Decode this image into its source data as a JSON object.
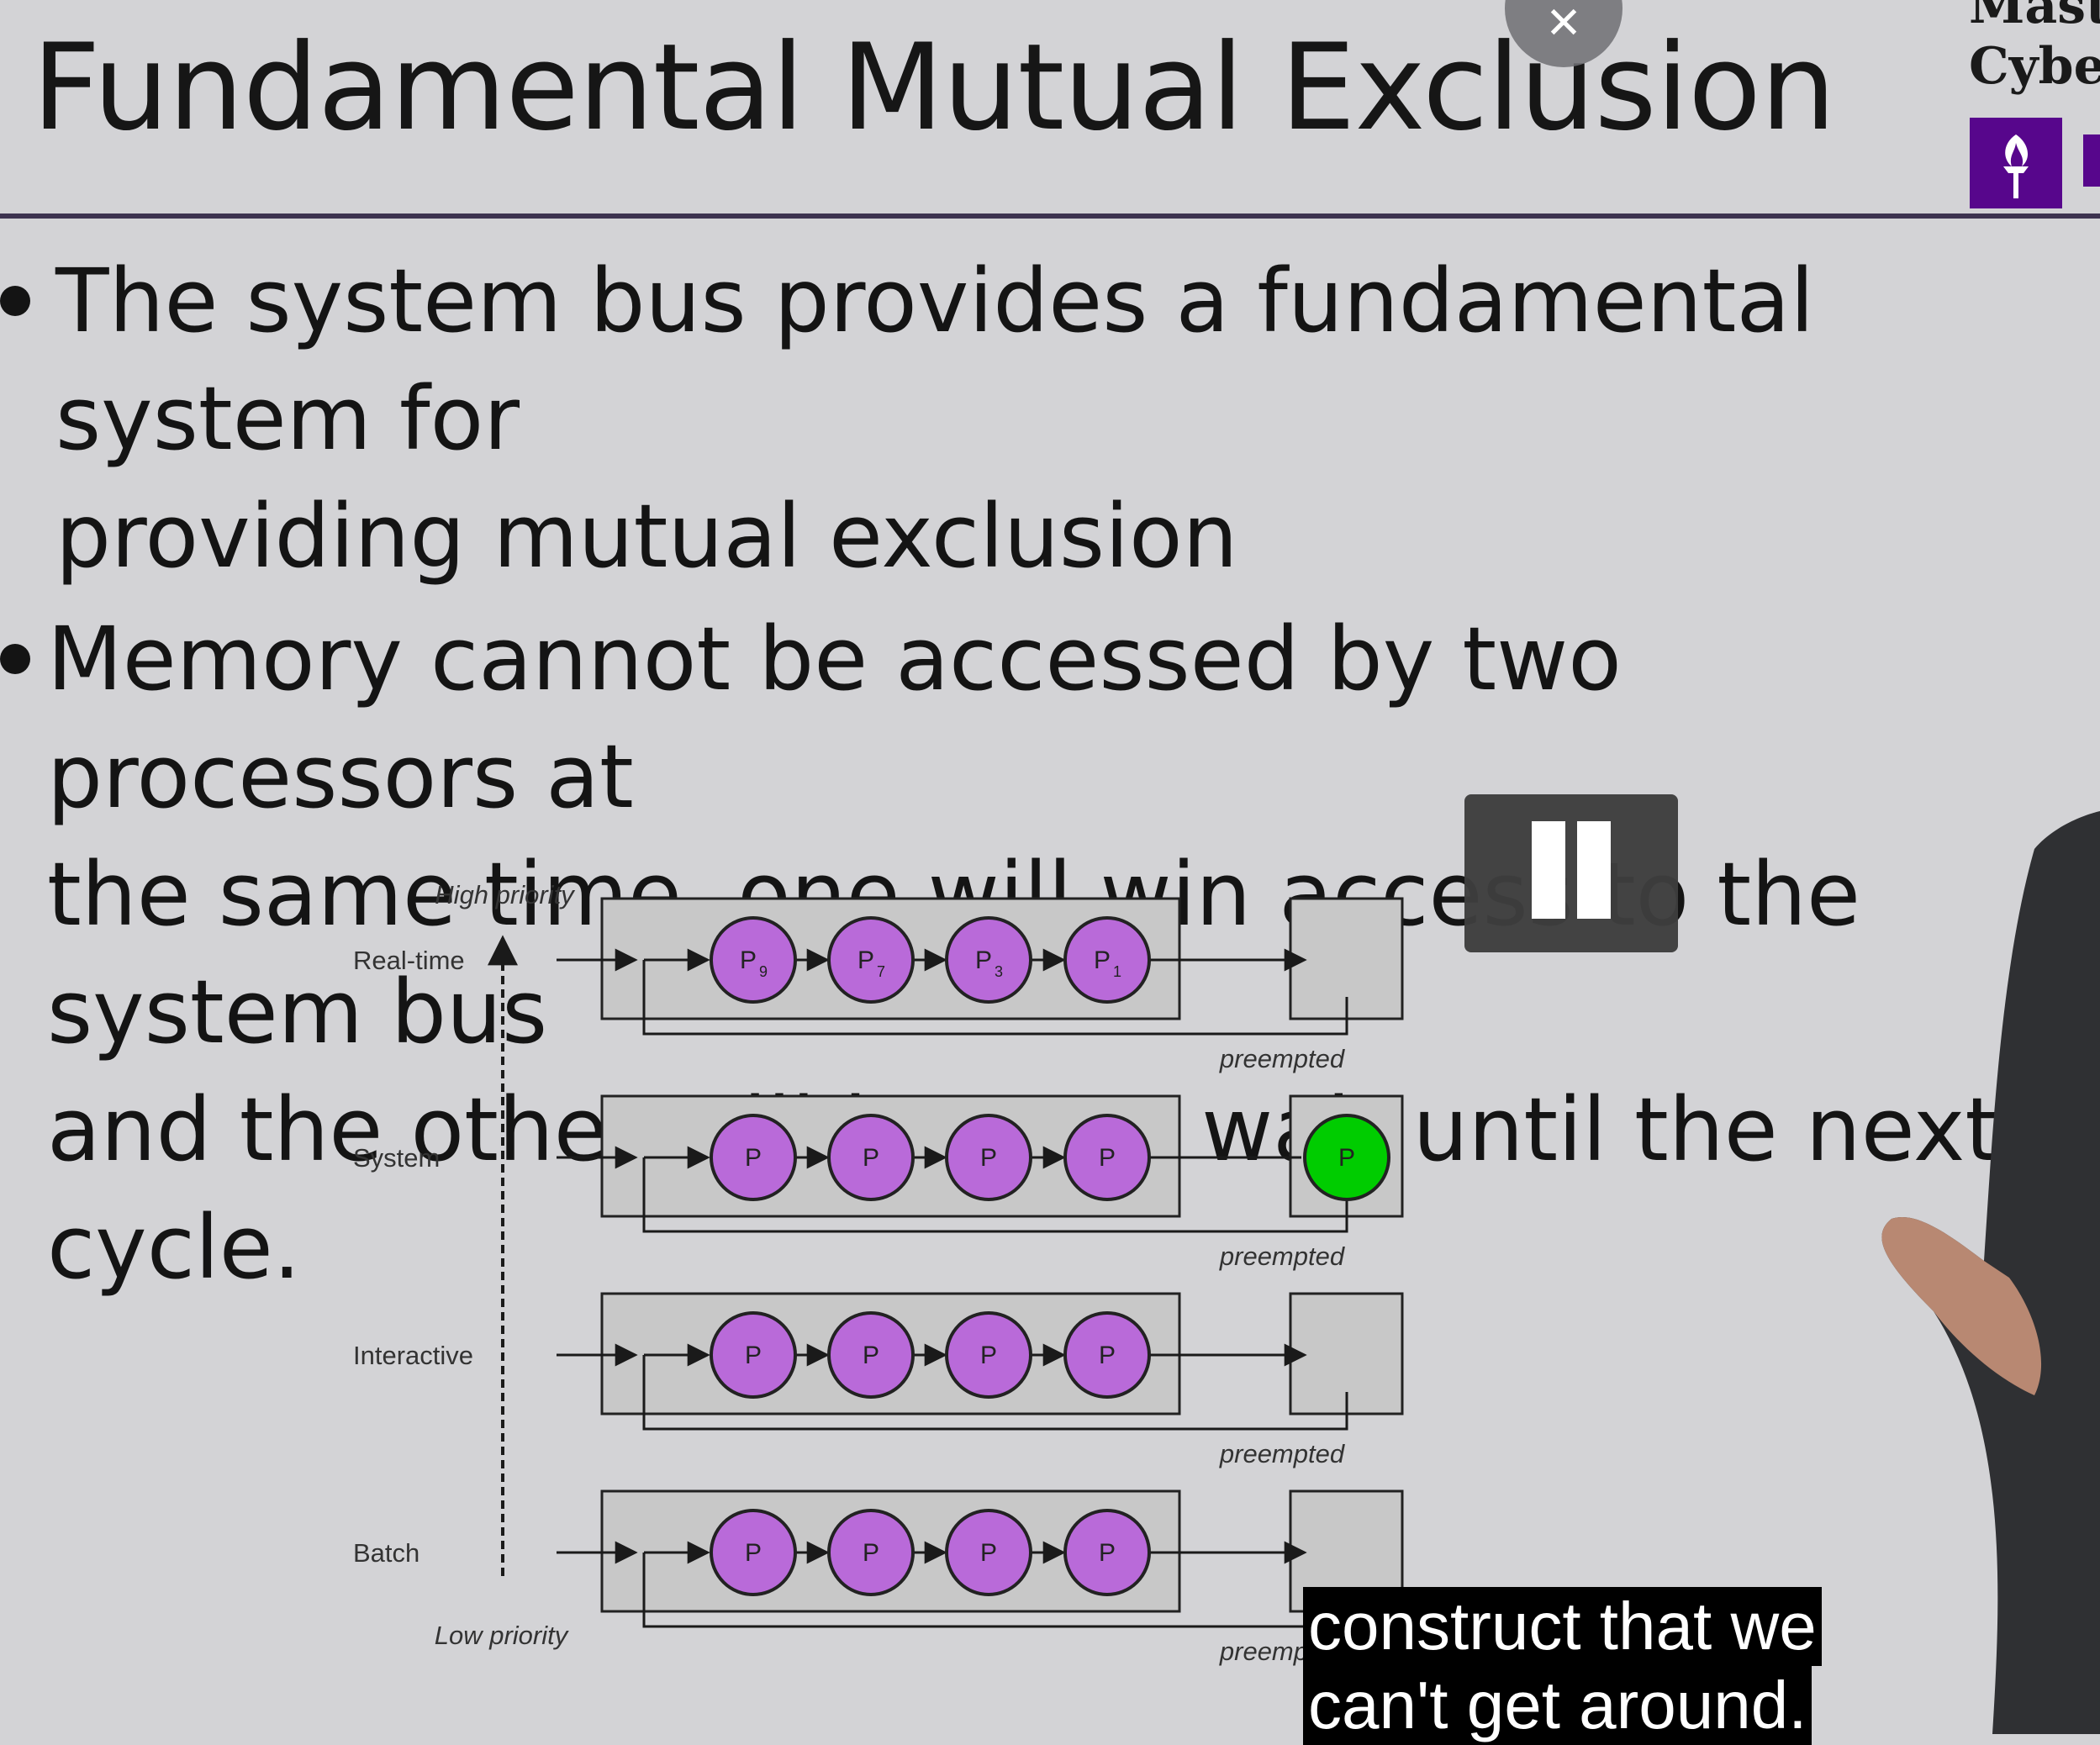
{
  "slide": {
    "title": "Fundamental Mutual Exclusion",
    "bullets": [
      "The system bus provides a fundamental system for\nproviding mutual exclusion",
      "Memory cannot be accessed by two processors at\nthe same time, one will win access to the system bus\nand the other will have to wait until the next cycle."
    ],
    "brand_line1": "Maste",
    "brand_line2": "Cyber",
    "accent_color": "#57068c"
  },
  "diagram": {
    "high_priority_label": "High priority",
    "low_priority_label": "Low priority",
    "preempted_label": "preempted",
    "process_color": "#b96ad9",
    "running_color": "#00cc00",
    "queues": [
      {
        "name": "Real-time",
        "processes": [
          {
            "letter": "P",
            "sub": "9"
          },
          {
            "letter": "P",
            "sub": "7"
          },
          {
            "letter": "P",
            "sub": "3"
          },
          {
            "letter": "P",
            "sub": "1"
          }
        ],
        "running": null
      },
      {
        "name": "System",
        "processes": [
          {
            "letter": "P",
            "sub": ""
          },
          {
            "letter": "P",
            "sub": ""
          },
          {
            "letter": "P",
            "sub": ""
          },
          {
            "letter": "P",
            "sub": ""
          }
        ],
        "running": "P"
      },
      {
        "name": "Interactive",
        "processes": [
          {
            "letter": "P",
            "sub": ""
          },
          {
            "letter": "P",
            "sub": ""
          },
          {
            "letter": "P",
            "sub": ""
          },
          {
            "letter": "P",
            "sub": ""
          }
        ],
        "running": null
      },
      {
        "name": "Batch",
        "processes": [
          {
            "letter": "P",
            "sub": ""
          },
          {
            "letter": "P",
            "sub": ""
          },
          {
            "letter": "P",
            "sub": ""
          },
          {
            "letter": "P",
            "sub": ""
          }
        ],
        "running": null
      }
    ]
  },
  "player": {
    "close_icon": "close-icon",
    "pause_icon": "pause-icon",
    "subtitle_lines": [
      "construct that we",
      "can't get around."
    ]
  }
}
